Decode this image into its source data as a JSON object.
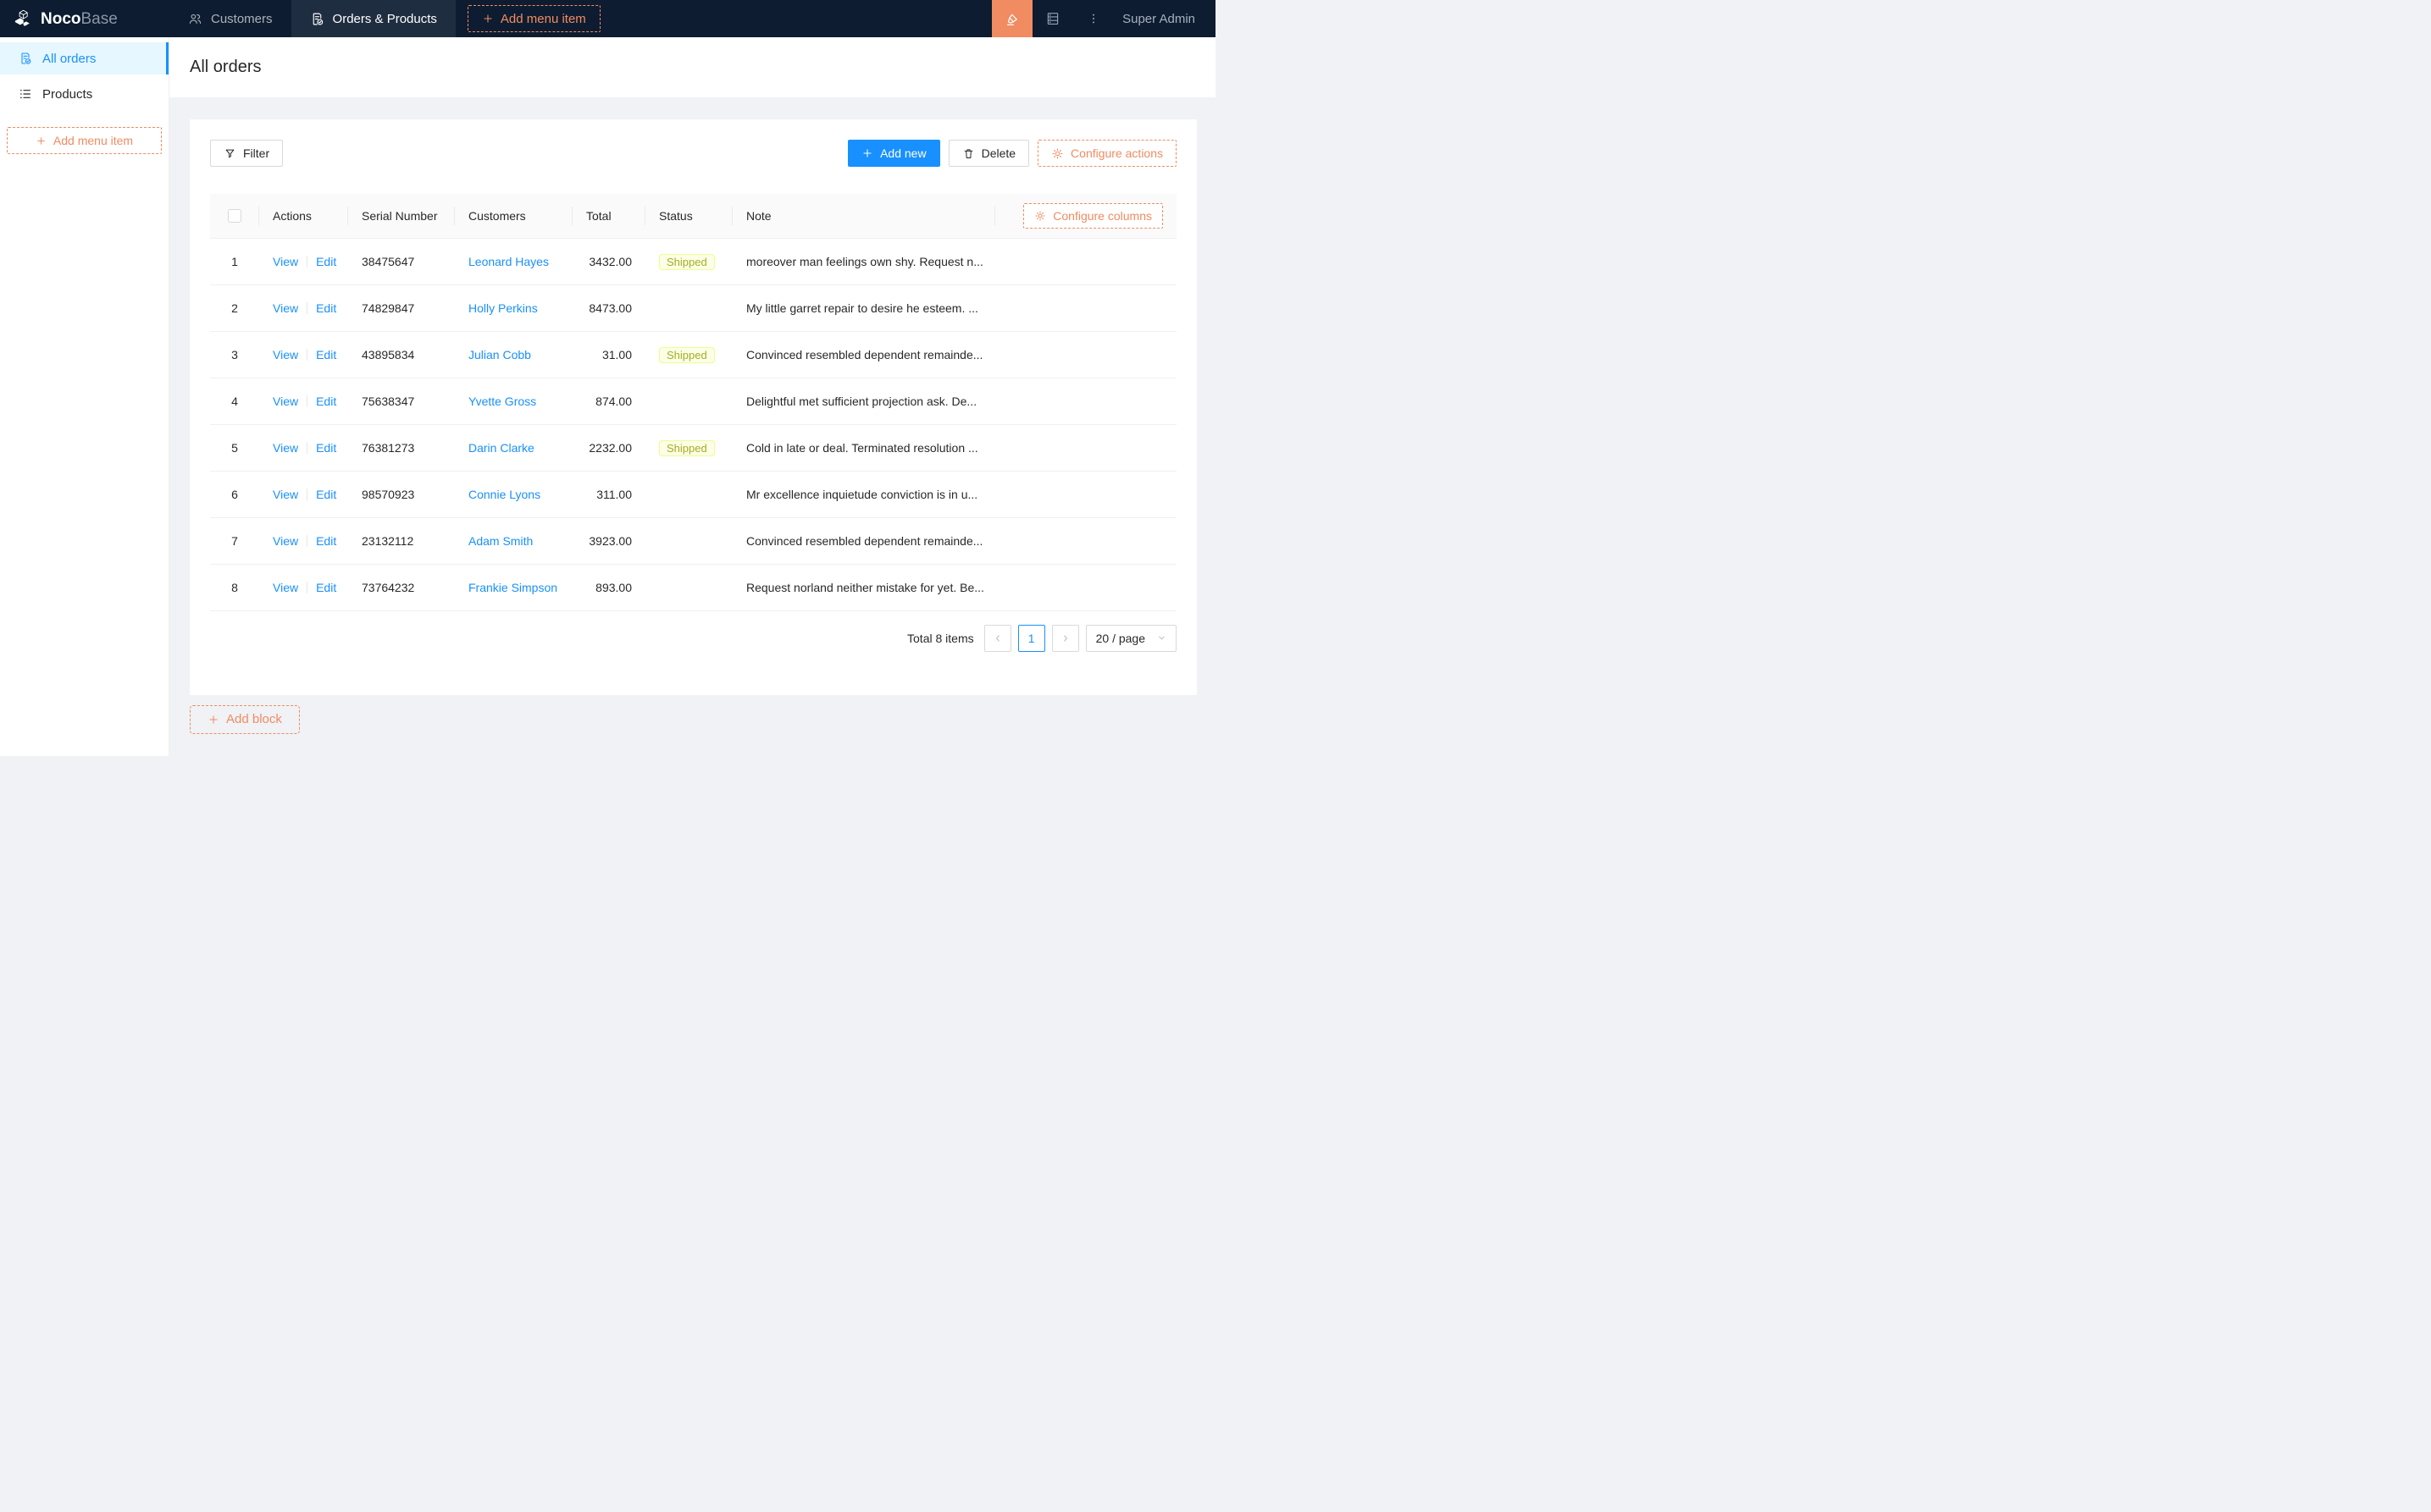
{
  "header": {
    "brand_bold": "Noco",
    "brand_light": "Base",
    "tabs": [
      {
        "label": "Customers",
        "icon": "team-icon",
        "active": false
      },
      {
        "label": "Orders & Products",
        "icon": "file-done-icon",
        "active": true
      }
    ],
    "add_menu_item_label": "Add menu item",
    "user": "Super Admin"
  },
  "sidebar": {
    "items": [
      {
        "label": "All orders",
        "icon": "file-done-icon",
        "active": true
      },
      {
        "label": "Products",
        "icon": "unordered-list-icon",
        "active": false
      }
    ],
    "add_menu_item_label": "Add menu item"
  },
  "page": {
    "title": "All orders"
  },
  "toolbar": {
    "filter_label": "Filter",
    "add_new_label": "Add new",
    "delete_label": "Delete",
    "configure_actions_label": "Configure actions"
  },
  "table": {
    "configure_columns_label": "Configure columns",
    "columns": [
      "Actions",
      "Serial Number",
      "Customers",
      "Total",
      "Status",
      "Note"
    ],
    "action_labels": {
      "view": "View",
      "edit": "Edit"
    },
    "rows": [
      {
        "index": 1,
        "serial": "38475647",
        "customer": "Leonard Hayes",
        "total": "3432.00",
        "status": "Shipped",
        "note": "moreover man feelings own shy. Request n..."
      },
      {
        "index": 2,
        "serial": "74829847",
        "customer": "Holly Perkins",
        "total": "8473.00",
        "status": "",
        "note": "My little garret repair to desire he esteem. ..."
      },
      {
        "index": 3,
        "serial": "43895834",
        "customer": "Julian Cobb",
        "total": "31.00",
        "status": "Shipped",
        "note": "Convinced resembled dependent remainde..."
      },
      {
        "index": 4,
        "serial": "75638347",
        "customer": "Yvette Gross",
        "total": "874.00",
        "status": "",
        "note": "Delightful met sufficient projection ask. De..."
      },
      {
        "index": 5,
        "serial": "76381273",
        "customer": "Darin Clarke",
        "total": "2232.00",
        "status": "Shipped",
        "note": "Cold in late or deal. Terminated resolution ..."
      },
      {
        "index": 6,
        "serial": "98570923",
        "customer": "Connie Lyons",
        "total": "311.00",
        "status": "",
        "note": "Mr excellence inquietude conviction is in u..."
      },
      {
        "index": 7,
        "serial": "23132112",
        "customer": "Adam Smith",
        "total": "3923.00",
        "status": "",
        "note": "Convinced resembled dependent remainde..."
      },
      {
        "index": 8,
        "serial": "73764232",
        "customer": "Frankie Simpson",
        "total": "893.00",
        "status": "",
        "note": "Request norland neither mistake for yet. Be..."
      }
    ]
  },
  "pagination": {
    "total_text": "Total 8 items",
    "current_page": "1",
    "page_size_label": "20 / page"
  },
  "footer": {
    "add_block_label": "Add block"
  },
  "colors": {
    "primary_blue": "#1890ff",
    "accent_orange": "#f18b62",
    "header_bg": "#0d1c30",
    "selected_menu_bg": "#e6f7ff",
    "status_tag_bg": "#fcffe6",
    "status_tag_border": "#eaff8f",
    "status_tag_text": "#a3ad25"
  }
}
